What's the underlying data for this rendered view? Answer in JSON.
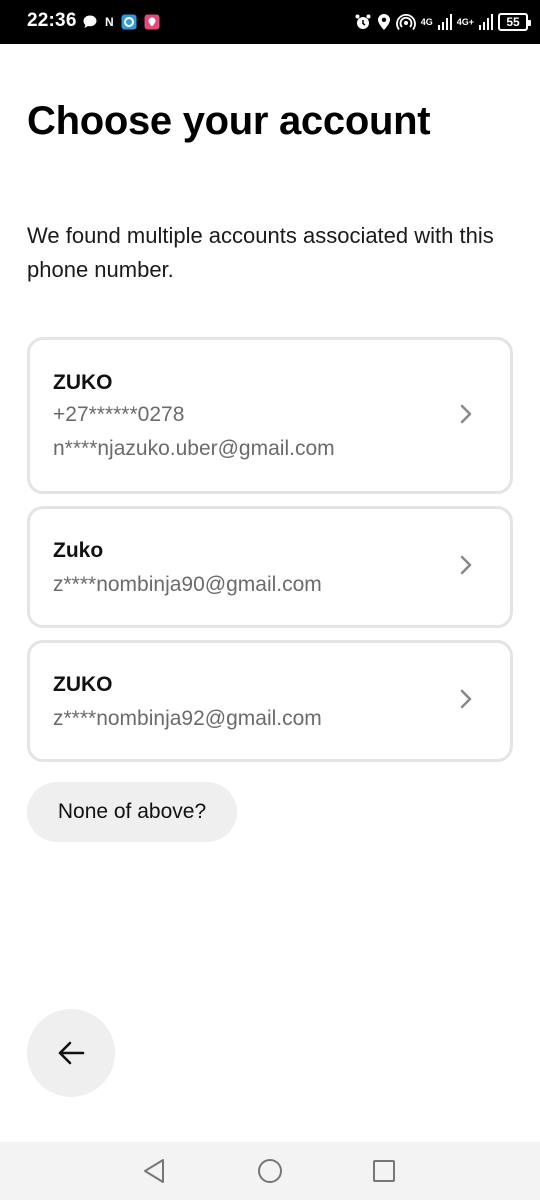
{
  "status_bar": {
    "time": "22:36",
    "notification_letter": "N",
    "network_1": "4G",
    "network_2": "4G+",
    "battery": "55"
  },
  "header": {
    "title": "Choose your account"
  },
  "main": {
    "subtitle": "We found multiple accounts associated with this phone number.",
    "accounts": [
      {
        "name": "ZUKO",
        "phone": "+27******0278",
        "email": "n****njazuko.uber@gmail.com"
      },
      {
        "name": "Zuko",
        "email": "z****nombinja90@gmail.com"
      },
      {
        "name": "ZUKO",
        "email": "z****nombinja92@gmail.com"
      }
    ],
    "none_label": "None of above?"
  },
  "icons": {
    "back": "arrow-left-icon",
    "chevron": "chevron-right-icon",
    "nav_back": "triangle-back-icon",
    "nav_home": "circle-home-icon",
    "nav_recents": "square-recents-icon"
  },
  "colors": {
    "card_border": "#e4e4e4",
    "pill_bg": "#efefef",
    "secondary_text": "#6b6b6b"
  }
}
